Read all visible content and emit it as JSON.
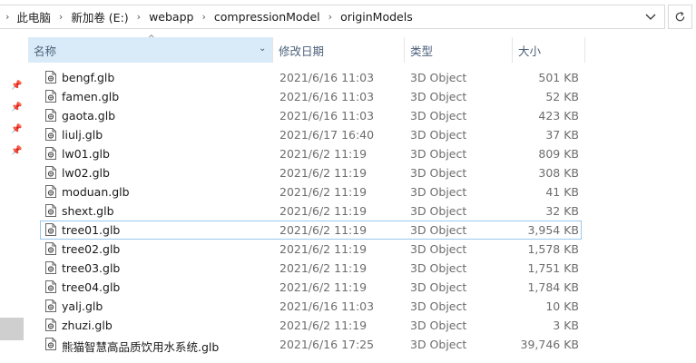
{
  "address": {
    "crumbs": [
      "此电脑",
      "新加卷 (E:)",
      "webapp",
      "compressionModel",
      "originModels"
    ]
  },
  "columns": {
    "name": "名称",
    "date": "修改日期",
    "type": "类型",
    "size": "大小"
  },
  "files": [
    {
      "name": "bengf.glb",
      "date": "2021/6/16 11:03",
      "type": "3D Object",
      "size": "501 KB"
    },
    {
      "name": "famen.glb",
      "date": "2021/6/16 11:03",
      "type": "3D Object",
      "size": "52 KB"
    },
    {
      "name": "gaota.glb",
      "date": "2021/6/16 11:03",
      "type": "3D Object",
      "size": "423 KB"
    },
    {
      "name": "liulj.glb",
      "date": "2021/6/17 16:40",
      "type": "3D Object",
      "size": "37 KB"
    },
    {
      "name": "lw01.glb",
      "date": "2021/6/2 11:19",
      "type": "3D Object",
      "size": "809 KB"
    },
    {
      "name": "lw02.glb",
      "date": "2021/6/2 11:19",
      "type": "3D Object",
      "size": "308 KB"
    },
    {
      "name": "moduan.glb",
      "date": "2021/6/2 11:19",
      "type": "3D Object",
      "size": "41 KB"
    },
    {
      "name": "shext.glb",
      "date": "2021/6/2 11:19",
      "type": "3D Object",
      "size": "32 KB"
    },
    {
      "name": "tree01.glb",
      "date": "2021/6/2 11:19",
      "type": "3D Object",
      "size": "3,954 KB"
    },
    {
      "name": "tree02.glb",
      "date": "2021/6/2 11:19",
      "type": "3D Object",
      "size": "1,578 KB"
    },
    {
      "name": "tree03.glb",
      "date": "2021/6/2 11:19",
      "type": "3D Object",
      "size": "1,751 KB"
    },
    {
      "name": "tree04.glb",
      "date": "2021/6/2 11:19",
      "type": "3D Object",
      "size": "1,784 KB"
    },
    {
      "name": "yalj.glb",
      "date": "2021/6/16 11:03",
      "type": "3D Object",
      "size": "10 KB"
    },
    {
      "name": "zhuzi.glb",
      "date": "2021/6/2 11:19",
      "type": "3D Object",
      "size": "3 KB"
    },
    {
      "name": "熊猫智慧高品质饮用水系统.glb",
      "date": "2021/6/16 17:25",
      "type": "3D Object",
      "size": "39,746 KB"
    }
  ],
  "focused_file": "tree01.glb",
  "colors": {
    "header_bg": "#d9ebf9",
    "focus_border": "#99c9ef",
    "header_text": "#4c607a"
  }
}
